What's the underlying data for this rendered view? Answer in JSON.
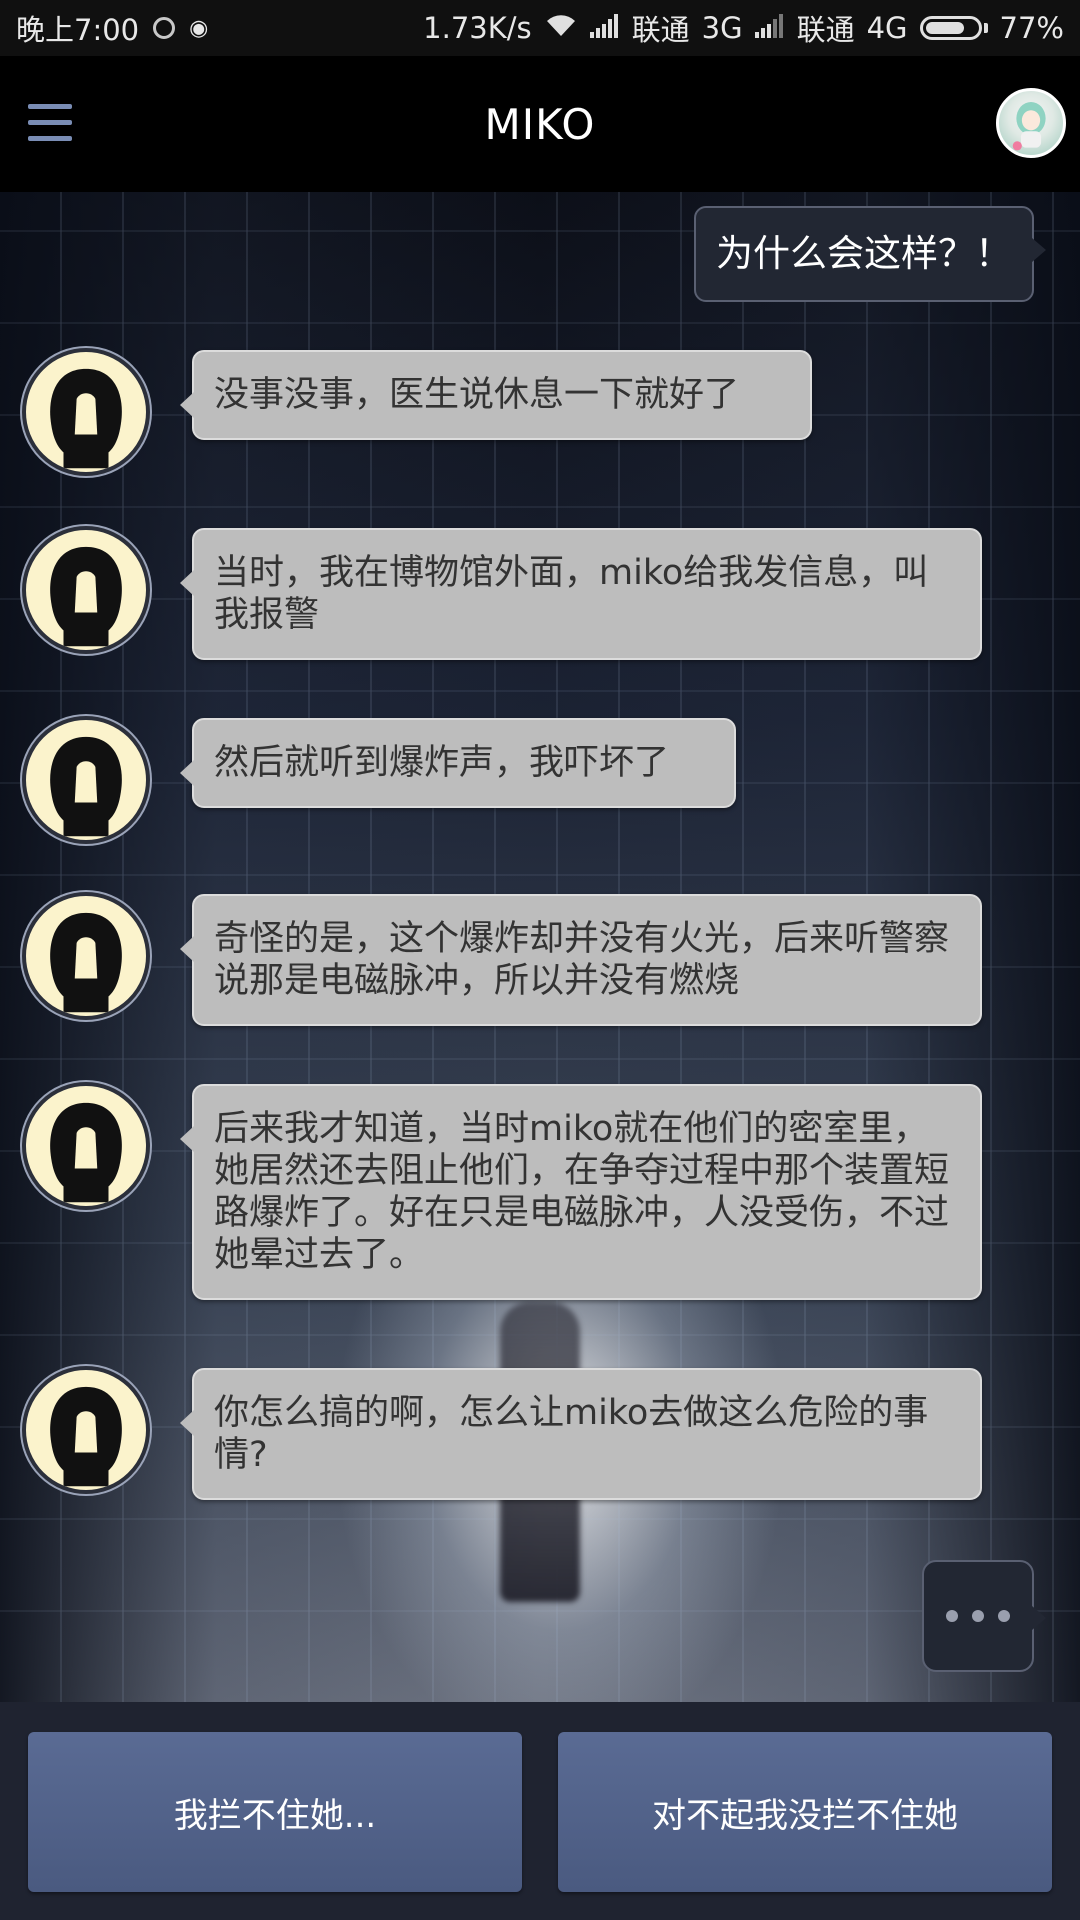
{
  "status_bar": {
    "time": "晚上7:00",
    "speed": "1.73K/s",
    "carrier1": "联通",
    "network1": "3G",
    "carrier2": "联通",
    "network2": "4G",
    "battery": "77%",
    "battery_level": 0.77
  },
  "app_bar": {
    "title": "MIKO",
    "menu_icon": "hamburger-menu-icon",
    "profile_icon": "profile-avatar"
  },
  "chat": {
    "outgoing": "为什么会这样？！",
    "messages": [
      "没事没事，医生说休息一下就好了",
      "当时，我在博物馆外面，miko给我发信息，叫我报警",
      "然后就听到爆炸声，我吓坏了",
      "奇怪的是，这个爆炸却并没有火光，后来听警察说那是电磁脉冲，所以并没有燃烧",
      "后来我才知道，当时miko就在他们的密室里，她居然还去阻止他们，在争夺过程中那个装置短路爆炸了。好在只是电磁脉冲，人没受伤，不过她晕过去了。",
      "你怎么搞的啊，怎么让miko去做这么危险的事情?"
    ],
    "typing_icon": "typing-dots-icon"
  },
  "replies": {
    "option1": "我拦不住她...",
    "option2": "对不起我没拦不住她"
  }
}
